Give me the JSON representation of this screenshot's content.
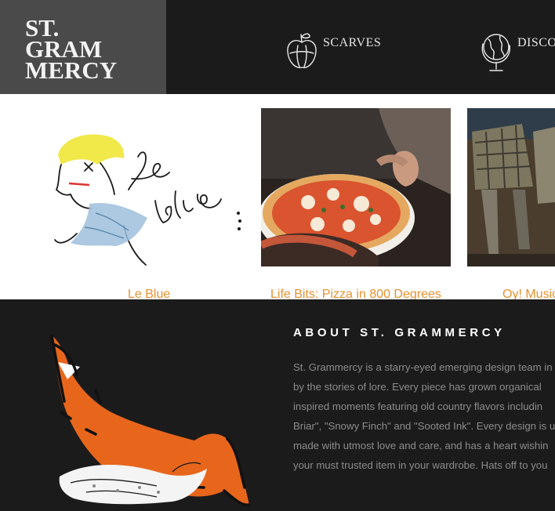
{
  "brand": {
    "line1": "ST.",
    "line2": "GRAM",
    "line3": "MERCY"
  },
  "nav": [
    {
      "label": "SCARVES",
      "icon": "apple-sketch-icon"
    },
    {
      "label": "DISCO",
      "icon": "globe-sketch-icon"
    }
  ],
  "gallery": [
    {
      "caption": "Le Blue",
      "image": "le-blue-illustration"
    },
    {
      "caption": "Life Bits: Pizza in 800 Degrees",
      "image": "pizza-photo"
    },
    {
      "caption": "Oy! Music",
      "image": "kilt-dancers-photo"
    }
  ],
  "about": {
    "title": "ABOUT ST. GRAMMERCY",
    "lines": [
      "St. Grammercy is a starry-eyed emerging design team in",
      "by the stories of lore. Every piece has grown organical",
      "inspired moments featuring old country flavors includin",
      "Briar\", \"Snowy Finch\" and \"Sooted Ink\". Every design is u",
      "made with utmost love and care, and has a heart wishin",
      "your must trusted item in your wardrobe. Hats off to you"
    ]
  },
  "colors": {
    "header_bg": "#1c1b1b",
    "logo_bg": "#4a4a4a",
    "caption": "#e8912f",
    "fox_orange": "#e8661c"
  }
}
